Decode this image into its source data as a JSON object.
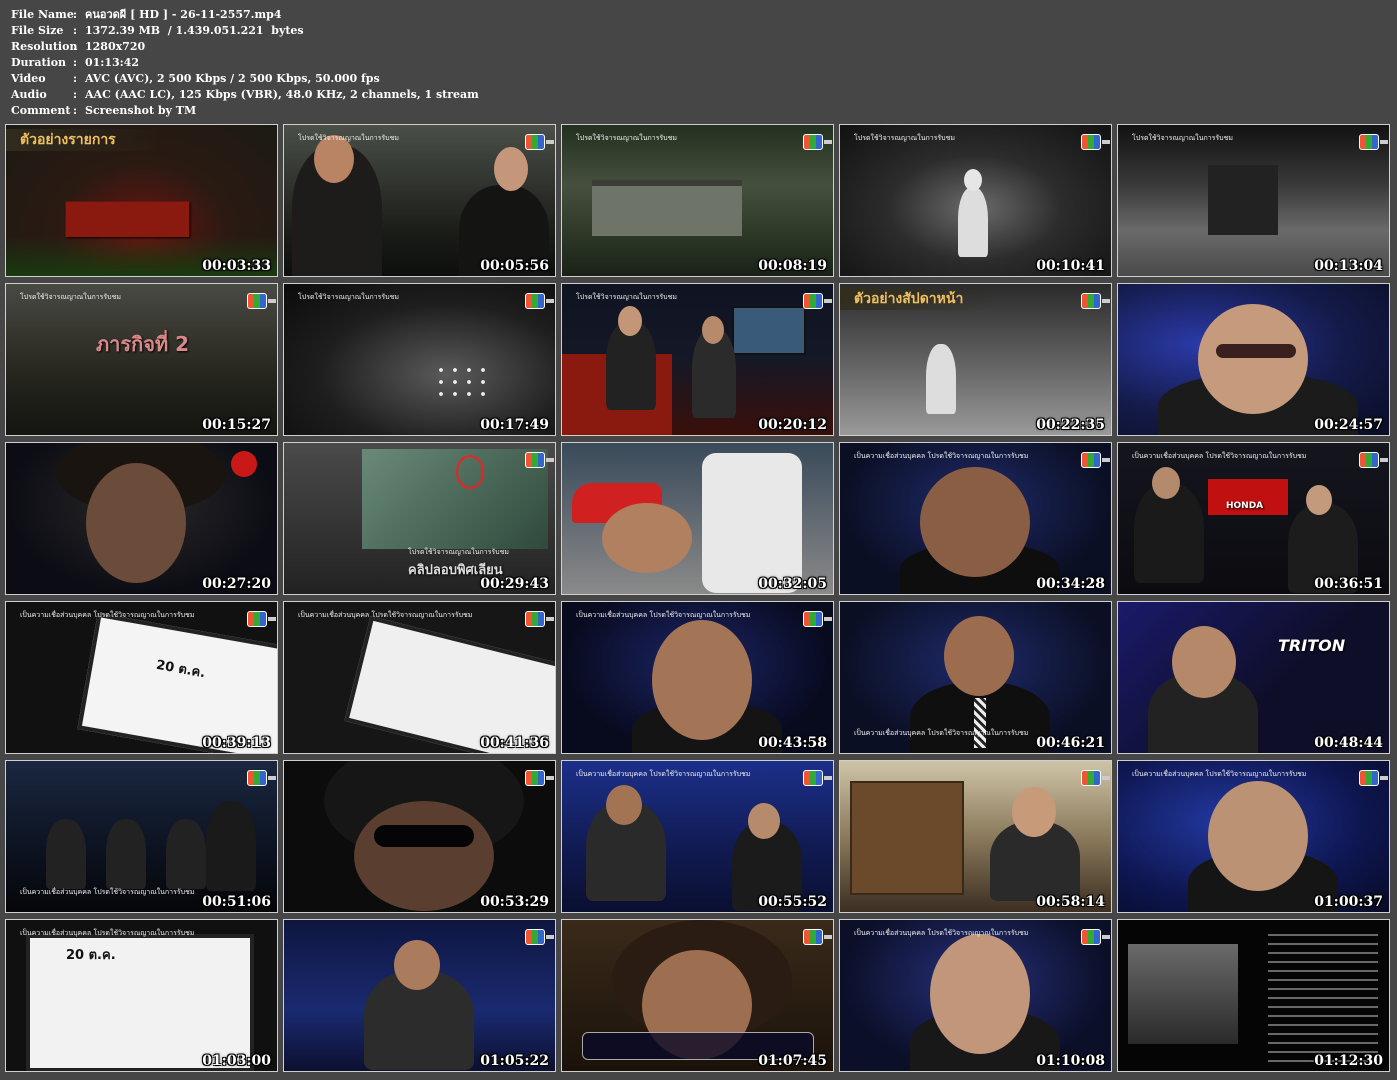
{
  "info": [
    {
      "label": "File Name",
      "value": "คนอวดผี [ HD ] - 26-11-2557.mp4"
    },
    {
      "label": "File Size",
      "value": "1372.39 MB  / 1.439.051.221  bytes"
    },
    {
      "label": "Resolution",
      "value": "1280x720"
    },
    {
      "label": "Duration",
      "value": "01:13:42"
    },
    {
      "label": "Video",
      "value": "AVC (AVC), 2 500 Kbps / 2 500 Kbps, 50.000 fps"
    },
    {
      "label": "Audio",
      "value": "AAC (AAC LC), 125 Kbps (VBR), 48.0 KHz, 2 channels, 1 stream"
    },
    {
      "label": "Comment",
      "value": "Screenshot by TM"
    }
  ],
  "colon": ":",
  "overlays": {
    "preview": "ตัวอย่างรายการ",
    "next_week": "ตัวอย่างสัปดาหน้า",
    "caution": "โปรดใช้วิจารณญาณในการรับชม",
    "belief": "เป็นความเชื่อส่วนบุคคล โปรดใช้วิจารณญาณในการรับชม",
    "mission": "ภารกิจที่ 2",
    "whiteboard": "20 ต.ค.",
    "honda": "HONDA",
    "triton": "TRITON",
    "clip": "คลิปลอบพิศเลียน"
  },
  "thumbs": [
    {
      "time": "00:03:33"
    },
    {
      "time": "00:05:56"
    },
    {
      "time": "00:08:19"
    },
    {
      "time": "00:10:41"
    },
    {
      "time": "00:13:04"
    },
    {
      "time": "00:15:27"
    },
    {
      "time": "00:17:49"
    },
    {
      "time": "00:20:12"
    },
    {
      "time": "00:22:35"
    },
    {
      "time": "00:24:57"
    },
    {
      "time": "00:27:20"
    },
    {
      "time": "00:29:43"
    },
    {
      "time": "00:32:05"
    },
    {
      "time": "00:34:28"
    },
    {
      "time": "00:36:51"
    },
    {
      "time": "00:39:13"
    },
    {
      "time": "00:41:36"
    },
    {
      "time": "00:43:58"
    },
    {
      "time": "00:46:21"
    },
    {
      "time": "00:48:44"
    },
    {
      "time": "00:51:06"
    },
    {
      "time": "00:53:29"
    },
    {
      "time": "00:55:52"
    },
    {
      "time": "00:58:14"
    },
    {
      "time": "01:00:37"
    },
    {
      "time": "01:03:00"
    },
    {
      "time": "01:05:22"
    },
    {
      "time": "01:07:45"
    },
    {
      "time": "01:10:08"
    },
    {
      "time": "01:12:30"
    }
  ]
}
